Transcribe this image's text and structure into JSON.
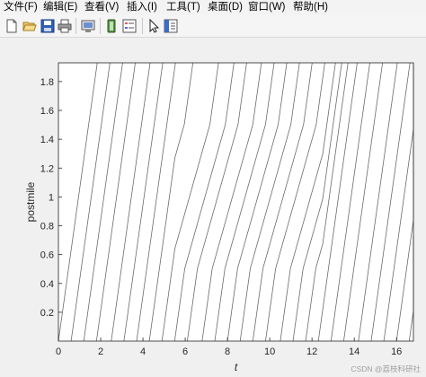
{
  "menubar": {
    "items": [
      "文件(F)",
      "编辑(E)",
      "查看(V)",
      "插入(I)",
      "工具(T)",
      "桌面(D)",
      "窗口(W)",
      "帮助(H)"
    ]
  },
  "toolbar": {
    "buttons": [
      "new-file-icon",
      "open-folder-icon",
      "save-icon",
      "print-icon",
      "print-preview-icon",
      "link-plot-icon",
      "insert-legend-icon",
      "pointer-icon",
      "property-editor-icon"
    ]
  },
  "colors": {
    "line": "#6a6a6a",
    "axis": "#262626",
    "figure_bg": "#f0f0f0",
    "plot_bg": "#ffffff"
  },
  "chart_data": {
    "type": "line",
    "title": "",
    "xlabel": "t",
    "ylabel": "postmile",
    "xlim": [
      0,
      16.8
    ],
    "ylim": [
      0,
      1.93
    ],
    "xticks": [
      0,
      2,
      4,
      6,
      8,
      10,
      12,
      14,
      16
    ],
    "yticks": [
      0.2,
      0.4,
      0.6,
      0.8,
      1,
      1.2,
      1.4,
      1.6,
      1.8
    ],
    "ytick_labels": [
      "0.2",
      "0.4",
      "0.6",
      "0.8",
      "1",
      "1.2",
      "1.4",
      "1.6",
      "1.8"
    ],
    "grid": false,
    "legend": "none",
    "trajectory_start_times_at_postmile_0": [
      0.0,
      0.6,
      1.2,
      1.8,
      2.5,
      3.1,
      3.7,
      4.3,
      4.9,
      5.5,
      6.1,
      6.8,
      7.4,
      8.0,
      8.6,
      9.2,
      9.8,
      10.5,
      11.1,
      11.7,
      12.3,
      12.9,
      13.5,
      14.2,
      14.8,
      15.4,
      16.0,
      16.6
    ],
    "free_flow_speed": 1.05,
    "congested_speed": 0.52,
    "congested_postmile_range": [
      0.5,
      1.5
    ],
    "congested_time_range": [
      5.5,
      12.5
    ]
  },
  "watermark": "CSDN @荔枝科研社"
}
